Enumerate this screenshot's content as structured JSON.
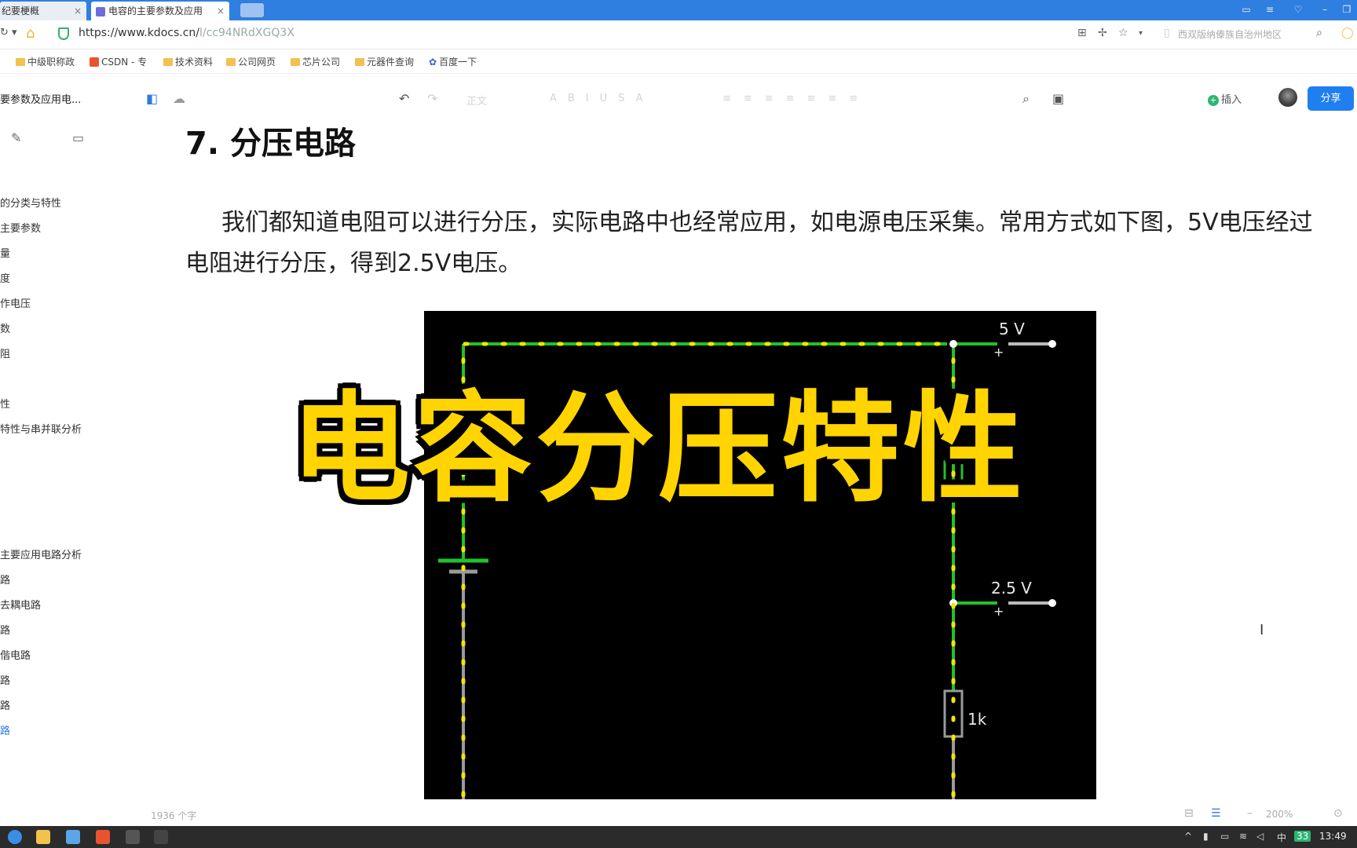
{
  "browser": {
    "tabs": [
      {
        "label": "纪要梗概"
      },
      {
        "label": "电容的主要参数及应用"
      }
    ],
    "url_main": "https://www.kdocs.cn/",
    "url_rest": "l/cc94NRdXGQ3X",
    "search_placeholder": "西双版纳傣族自治州地区"
  },
  "bookmarks": [
    {
      "label": "中级职称政",
      "icon": "folder"
    },
    {
      "label": "CSDN - 专",
      "icon": "csdn"
    },
    {
      "label": "技术资料",
      "icon": "folder"
    },
    {
      "label": "公司网页",
      "icon": "folder"
    },
    {
      "label": "芯片公司",
      "icon": "folder"
    },
    {
      "label": "元器件查询",
      "icon": "folder"
    },
    {
      "label": "百度一下",
      "icon": "paw"
    }
  ],
  "sidebar": {
    "doc_title": "要参数及应用电...",
    "toc": [
      {
        "label": "的分类与特性"
      },
      {
        "label": "主要参数"
      },
      {
        "label": "量"
      },
      {
        "label": "度"
      },
      {
        "label": "作电压"
      },
      {
        "label": "数"
      },
      {
        "label": "阻"
      },
      {
        "label": "性"
      },
      {
        "label": "特性与串并联分析"
      },
      {
        "label": "主要应用电路分析"
      },
      {
        "label": "路"
      },
      {
        "label": "去耦电路"
      },
      {
        "label": "路"
      },
      {
        "label": "偕电路"
      },
      {
        "label": "路"
      },
      {
        "label": "路"
      },
      {
        "label": "路"
      }
    ]
  },
  "toolbar": {
    "insert_label": "插入",
    "share_label": "分享",
    "faint_style": "正文"
  },
  "content": {
    "heading": "7.  分压电路",
    "paragraph": "我们都知道电阻可以进行分压，实际电路中也经常应用，如电源电压采集。常用方式如下图，5V电压经过电阻进行分压，得到2.5V电压。"
  },
  "circuit": {
    "label_5v": "5 V",
    "label_25v": "2.5 V",
    "r1": "1k",
    "r2": "1k",
    "plus": "+",
    "colors": {
      "wire": "#22c12a",
      "current": "#f2e600",
      "gray": "#9a9a9a"
    }
  },
  "overlay_title": "电容分压特性",
  "statusbar": {
    "word_count": "1936 个字",
    "zoom": "200%"
  },
  "taskbar": {
    "clock": "13:49",
    "ime": "中",
    "badge": "33"
  }
}
